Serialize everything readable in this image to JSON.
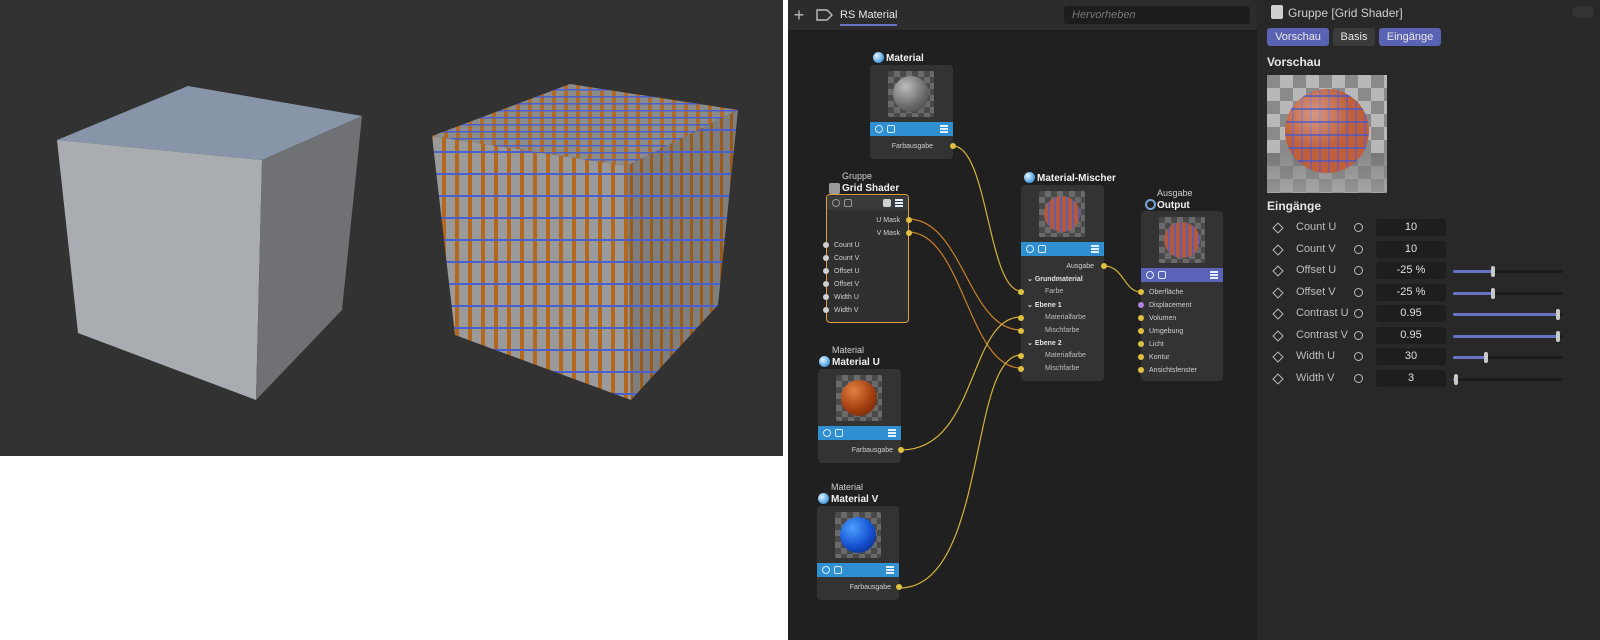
{
  "viewport": {
    "cubes": [
      "plain-cube",
      "grid-textured-cube"
    ]
  },
  "node_editor": {
    "tab": "RS Material",
    "search_placeholder": "Hervorheben",
    "nodes": {
      "material": {
        "title": "Material",
        "output": "Farbausgabe"
      },
      "grid_shader": {
        "caption": "Gruppe",
        "title": "Grid Shader",
        "outputs": [
          "U Mask",
          "V Mask"
        ],
        "inputs": [
          "Count U",
          "Count V",
          "Offset U",
          "Offset V",
          "Width U",
          "Width V"
        ]
      },
      "material_u": {
        "caption": "Material",
        "title": "Material U",
        "output": "Farbausgabe"
      },
      "material_v": {
        "caption": "Material",
        "title": "Material V",
        "output": "Farbausgabe"
      },
      "mixer": {
        "title": "Material-Mischer",
        "output": "Ausgabe",
        "groups": [
          {
            "name": "Grundmaterial",
            "ports": [
              "Farbe"
            ]
          },
          {
            "name": "Ebene 1",
            "ports": [
              "Materialfarbe",
              "Mischfarbe"
            ]
          },
          {
            "name": "Ebene 2",
            "ports": [
              "Materialfarbe",
              "Mischfarbe"
            ]
          }
        ]
      },
      "output": {
        "caption": "Ausgabe",
        "title": "Output",
        "inputs": [
          "Oberfläche",
          "Displacement",
          "Volumen",
          "Umgebung",
          "Licht",
          "Kontur",
          "Ansichtsfenster"
        ]
      }
    }
  },
  "attributes": {
    "title": "Gruppe [Grid Shader]",
    "tabs": [
      "Vorschau",
      "Basis",
      "Eingänge"
    ],
    "section_preview": "Vorschau",
    "section_inputs": "Eingänge",
    "params": [
      {
        "label": "Count U",
        "value": "10"
      },
      {
        "label": "Count V",
        "value": "10"
      },
      {
        "label": "Offset U",
        "value": "-25 %",
        "slider": 0.36
      },
      {
        "label": "Offset V",
        "value": "-25 %",
        "slider": 0.36
      },
      {
        "label": "Contrast U",
        "value": "0.95",
        "slider": 0.95
      },
      {
        "label": "Contrast V",
        "value": "0.95",
        "slider": 0.95
      },
      {
        "label": "Width U",
        "value": "30",
        "slider": 0.3
      },
      {
        "label": "Width V",
        "value": "3",
        "slider": 0.03
      }
    ]
  },
  "colors": {
    "accent": "#5a62b4",
    "node_bar": "#2f8fd0",
    "wire": "#d4b23a",
    "grid_orange": "#b36a2a",
    "grid_blue": "#4a5fd0"
  }
}
